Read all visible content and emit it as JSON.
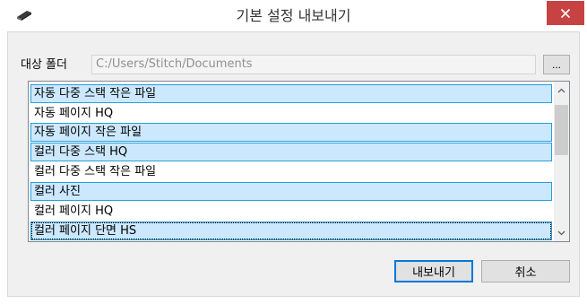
{
  "window": {
    "title": "기본 설정 내보내기",
    "close_symbol": "×"
  },
  "folder": {
    "label": "대상 폴더",
    "path": "C:/Users/Stitch/Documents",
    "browse_label": "..."
  },
  "list": {
    "items": [
      {
        "label": "자동 다중 스택 작은 파일",
        "selected": true
      },
      {
        "label": "자동 페이지 HQ",
        "selected": false
      },
      {
        "label": "자동 페이지 작은 파일",
        "selected": true
      },
      {
        "label": "컬러 다중 스택 HQ",
        "selected": true
      },
      {
        "label": "컬러 다중 스택 작은 파일",
        "selected": false
      },
      {
        "label": "컬러 사진",
        "selected": true
      },
      {
        "label": "컬러 페이지 HQ",
        "selected": false
      },
      {
        "label": "컬러 페이지 단면 HS",
        "selected": true,
        "focused": true
      }
    ]
  },
  "buttons": {
    "export_label": "내보내기",
    "cancel_label": "취소"
  },
  "colors": {
    "close_bg": "#c74343",
    "selection_bg": "#cce8ff",
    "selection_border": "#26a0da",
    "default_button_border": "#0078d7"
  }
}
